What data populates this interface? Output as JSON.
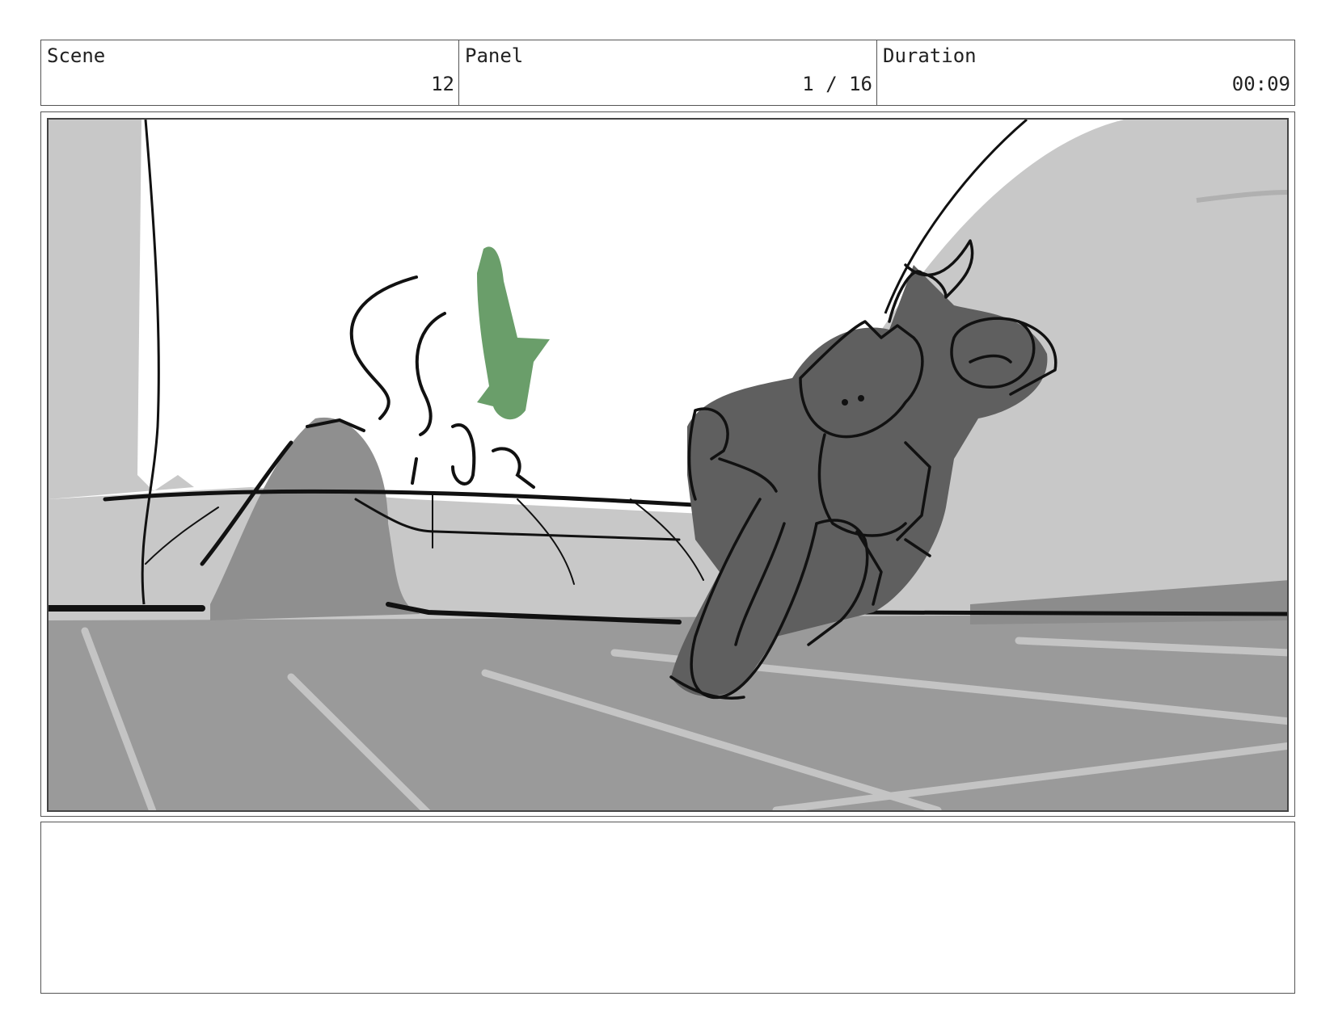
{
  "header": {
    "scene_label": "Scene",
    "scene_value": "12",
    "panel_label": "Panel",
    "panel_value": "1 / 16",
    "duration_label": "Duration",
    "duration_value": "00:09"
  },
  "drawing": {
    "description_colors": {
      "sky": "#ffffff",
      "far_ground": "#c8c8c8",
      "road": "#9a9a9a",
      "figure_fill": "#5f5f5f",
      "accent_green": "#6a9e6a",
      "ink": "#111111"
    }
  },
  "notes": {
    "text": ""
  }
}
